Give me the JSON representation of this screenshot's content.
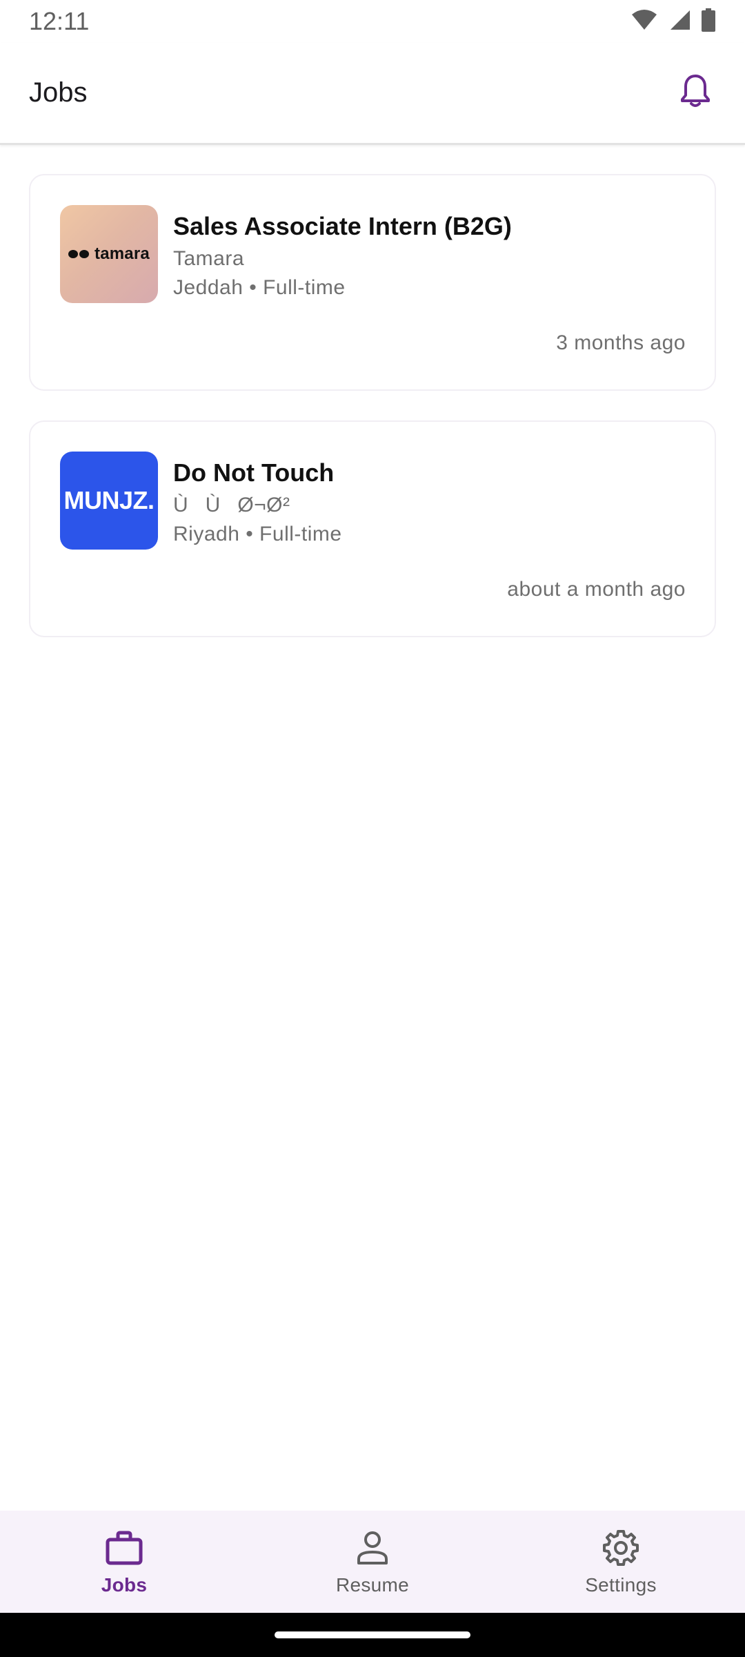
{
  "status_bar": {
    "time": "12:11",
    "icons": [
      "wifi-icon",
      "signal-icon",
      "battery-icon"
    ]
  },
  "app_bar": {
    "title": "Jobs",
    "action_icon": "bell-icon"
  },
  "jobs": [
    {
      "title": "Sales Associate Intern (B2G)",
      "company": "Tamara",
      "meta": "Jeddah • Full-time",
      "posted": "3 months ago",
      "logo_text": "tamara"
    },
    {
      "title": "Do Not Touch",
      "company": "ÙÙØ¬Ø²",
      "meta": "Riyadh • Full-time",
      "posted": "about a month ago",
      "logo_text": "MUNJZ."
    }
  ],
  "bottom_nav": {
    "items": [
      {
        "label": "Jobs",
        "icon": "briefcase-icon",
        "active": true
      },
      {
        "label": "Resume",
        "icon": "person-icon",
        "active": false
      },
      {
        "label": "Settings",
        "icon": "gear-icon",
        "active": false
      }
    ]
  },
  "colors": {
    "accent": "#6b2a8f",
    "nav_background": "#f7f2fa",
    "munjz_brand": "#2c55ea"
  }
}
